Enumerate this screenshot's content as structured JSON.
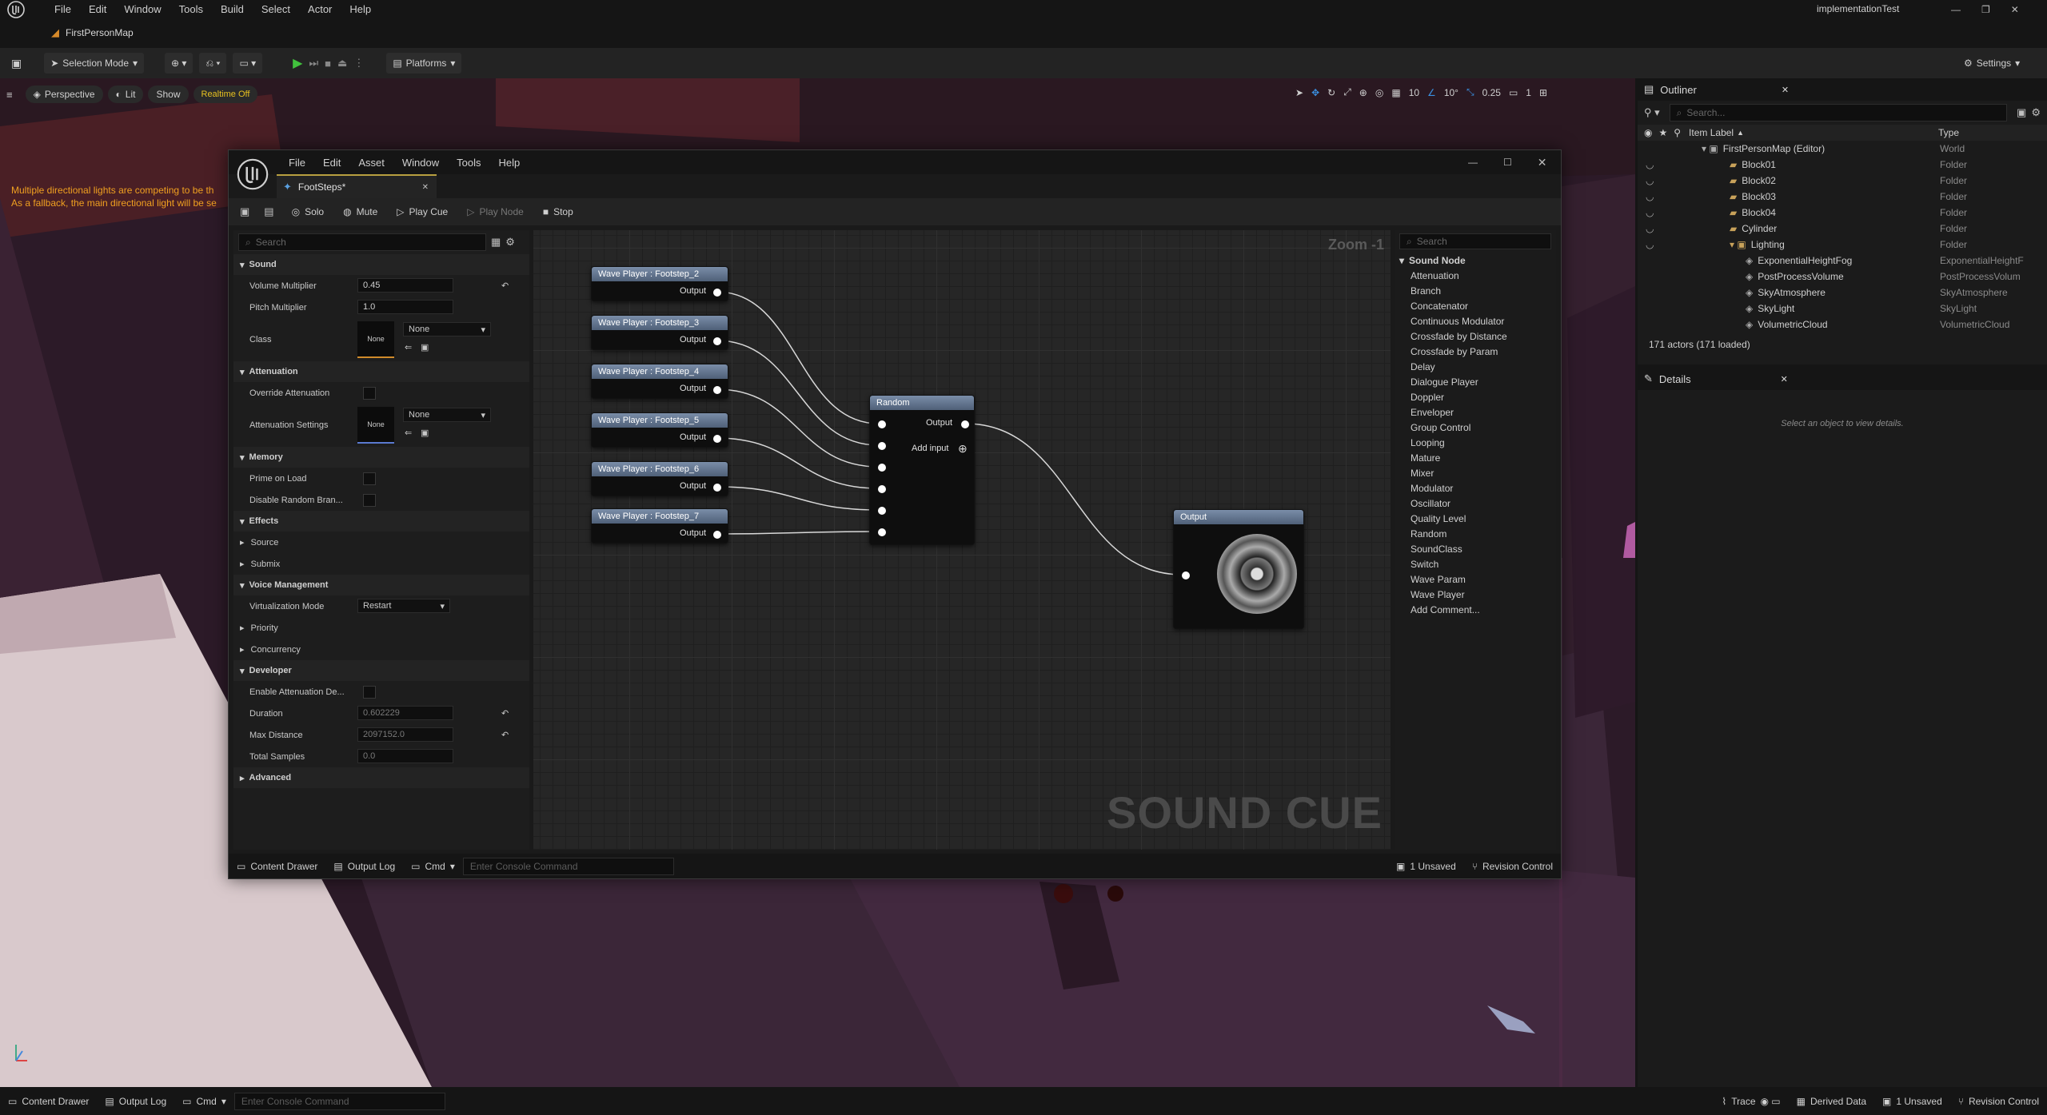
{
  "menu": [
    "File",
    "Edit",
    "Window",
    "Tools",
    "Build",
    "Select",
    "Actor",
    "Help"
  ],
  "project_name": "implementationTest",
  "map_tab": "FirstPersonMap",
  "toolbar": {
    "selection_mode": "Selection Mode",
    "platforms": "Platforms",
    "settings": "Settings"
  },
  "viewport": {
    "perspective": "Perspective",
    "lit": "Lit",
    "show": "Show",
    "realtime": "Realtime Off",
    "warning_1": "Multiple directional lights are competing to be th",
    "warning_2": "As a fallback, the main directional light will be se",
    "grid_size": "10",
    "rot_snap": "10°",
    "scale_snap": "0.25",
    "cam_speed": "1"
  },
  "outliner": {
    "title": "Outliner",
    "search_placeholder": "Search...",
    "col_label": "Item Label",
    "col_type": "Type",
    "rows": [
      {
        "label": "FirstPersonMap (Editor)",
        "type": "World"
      },
      {
        "label": "Block01",
        "type": "Folder"
      },
      {
        "label": "Block02",
        "type": "Folder"
      },
      {
        "label": "Block03",
        "type": "Folder"
      },
      {
        "label": "Block04",
        "type": "Folder"
      },
      {
        "label": "Cylinder",
        "type": "Folder"
      },
      {
        "label": "Lighting",
        "type": "Folder"
      },
      {
        "label": "ExponentialHeightFog",
        "type": "ExponentialHeightF"
      },
      {
        "label": "PostProcessVolume",
        "type": "PostProcessVolum"
      },
      {
        "label": "SkyAtmosphere",
        "type": "SkyAtmosphere"
      },
      {
        "label": "SkyLight",
        "type": "SkyLight"
      },
      {
        "label": "VolumetricCloud",
        "type": "VolumetricCloud"
      }
    ],
    "footer": "171 actors (171 loaded)"
  },
  "details": {
    "title": "Details",
    "empty": "Select an object to view details."
  },
  "status": {
    "content_drawer": "Content Drawer",
    "output_log": "Output Log",
    "cmd": "Cmd",
    "console_placeholder": "Enter Console Command",
    "trace": "Trace",
    "derived_data": "Derived Data",
    "unsaved": "1 Unsaved",
    "revision": "Revision Control"
  },
  "cue": {
    "menu": [
      "File",
      "Edit",
      "Asset",
      "Window",
      "Tools",
      "Help"
    ],
    "tab": "FootSteps*",
    "toolbar": {
      "solo": "Solo",
      "mute": "Mute",
      "play_cue": "Play Cue",
      "play_node": "Play Node",
      "stop": "Stop"
    },
    "details_search": "Search",
    "sections": {
      "sound": "Sound",
      "attenuation": "Attenuation",
      "memory": "Memory",
      "effects": "Effects",
      "voice": "Voice Management",
      "developer": "Developer",
      "advanced": "Advanced"
    },
    "props": {
      "volume_label": "Volume Multiplier",
      "volume": "0.45",
      "pitch_label": "Pitch Multiplier",
      "pitch": "1.0",
      "class_label": "Class",
      "class_thumb": "None",
      "class_val": "None",
      "override_att": "Override Attenuation",
      "att_settings": "Attenuation Settings",
      "att_thumb": "None",
      "att_val": "None",
      "prime": "Prime on Load",
      "disable_random": "Disable Random Bran...",
      "source": "Source",
      "submix": "Submix",
      "virt_label": "Virtualization Mode",
      "virt": "Restart",
      "priority": "Priority",
      "concurrency": "Concurrency",
      "enable_att_debug": "Enable Attenuation De...",
      "duration_label": "Duration",
      "duration": "0.602229",
      "maxdist_label": "Max Distance",
      "maxdist": "2097152.0",
      "samples_label": "Total Samples",
      "samples": "0.0"
    },
    "graph": {
      "zoom": "Zoom -1",
      "watermark": "SOUND CUE",
      "wave_nodes": [
        "Wave Player : Footstep_2",
        "Wave Player : Footstep_3",
        "Wave Player : Footstep_4",
        "Wave Player : Footstep_5",
        "Wave Player : Footstep_6",
        "Wave Player : Footstep_7"
      ],
      "pin_output": "Output",
      "random_title": "Random",
      "add_input": "Add input",
      "output_title": "Output"
    },
    "palette": {
      "search": "Search",
      "category": "Sound Node",
      "items": [
        "Attenuation",
        "Branch",
        "Concatenator",
        "Continuous Modulator",
        "Crossfade by Distance",
        "Crossfade by Param",
        "Delay",
        "Dialogue Player",
        "Doppler",
        "Enveloper",
        "Group Control",
        "Looping",
        "Mature",
        "Mixer",
        "Modulator",
        "Oscillator",
        "Quality Level",
        "Random",
        "SoundClass",
        "Switch",
        "Wave Param",
        "Wave Player",
        "Add Comment..."
      ]
    },
    "status": {
      "content_drawer": "Content Drawer",
      "output_log": "Output Log",
      "cmd": "Cmd",
      "console": "Enter Console Command",
      "unsaved": "1 Unsaved",
      "revision": "Revision Control"
    }
  }
}
